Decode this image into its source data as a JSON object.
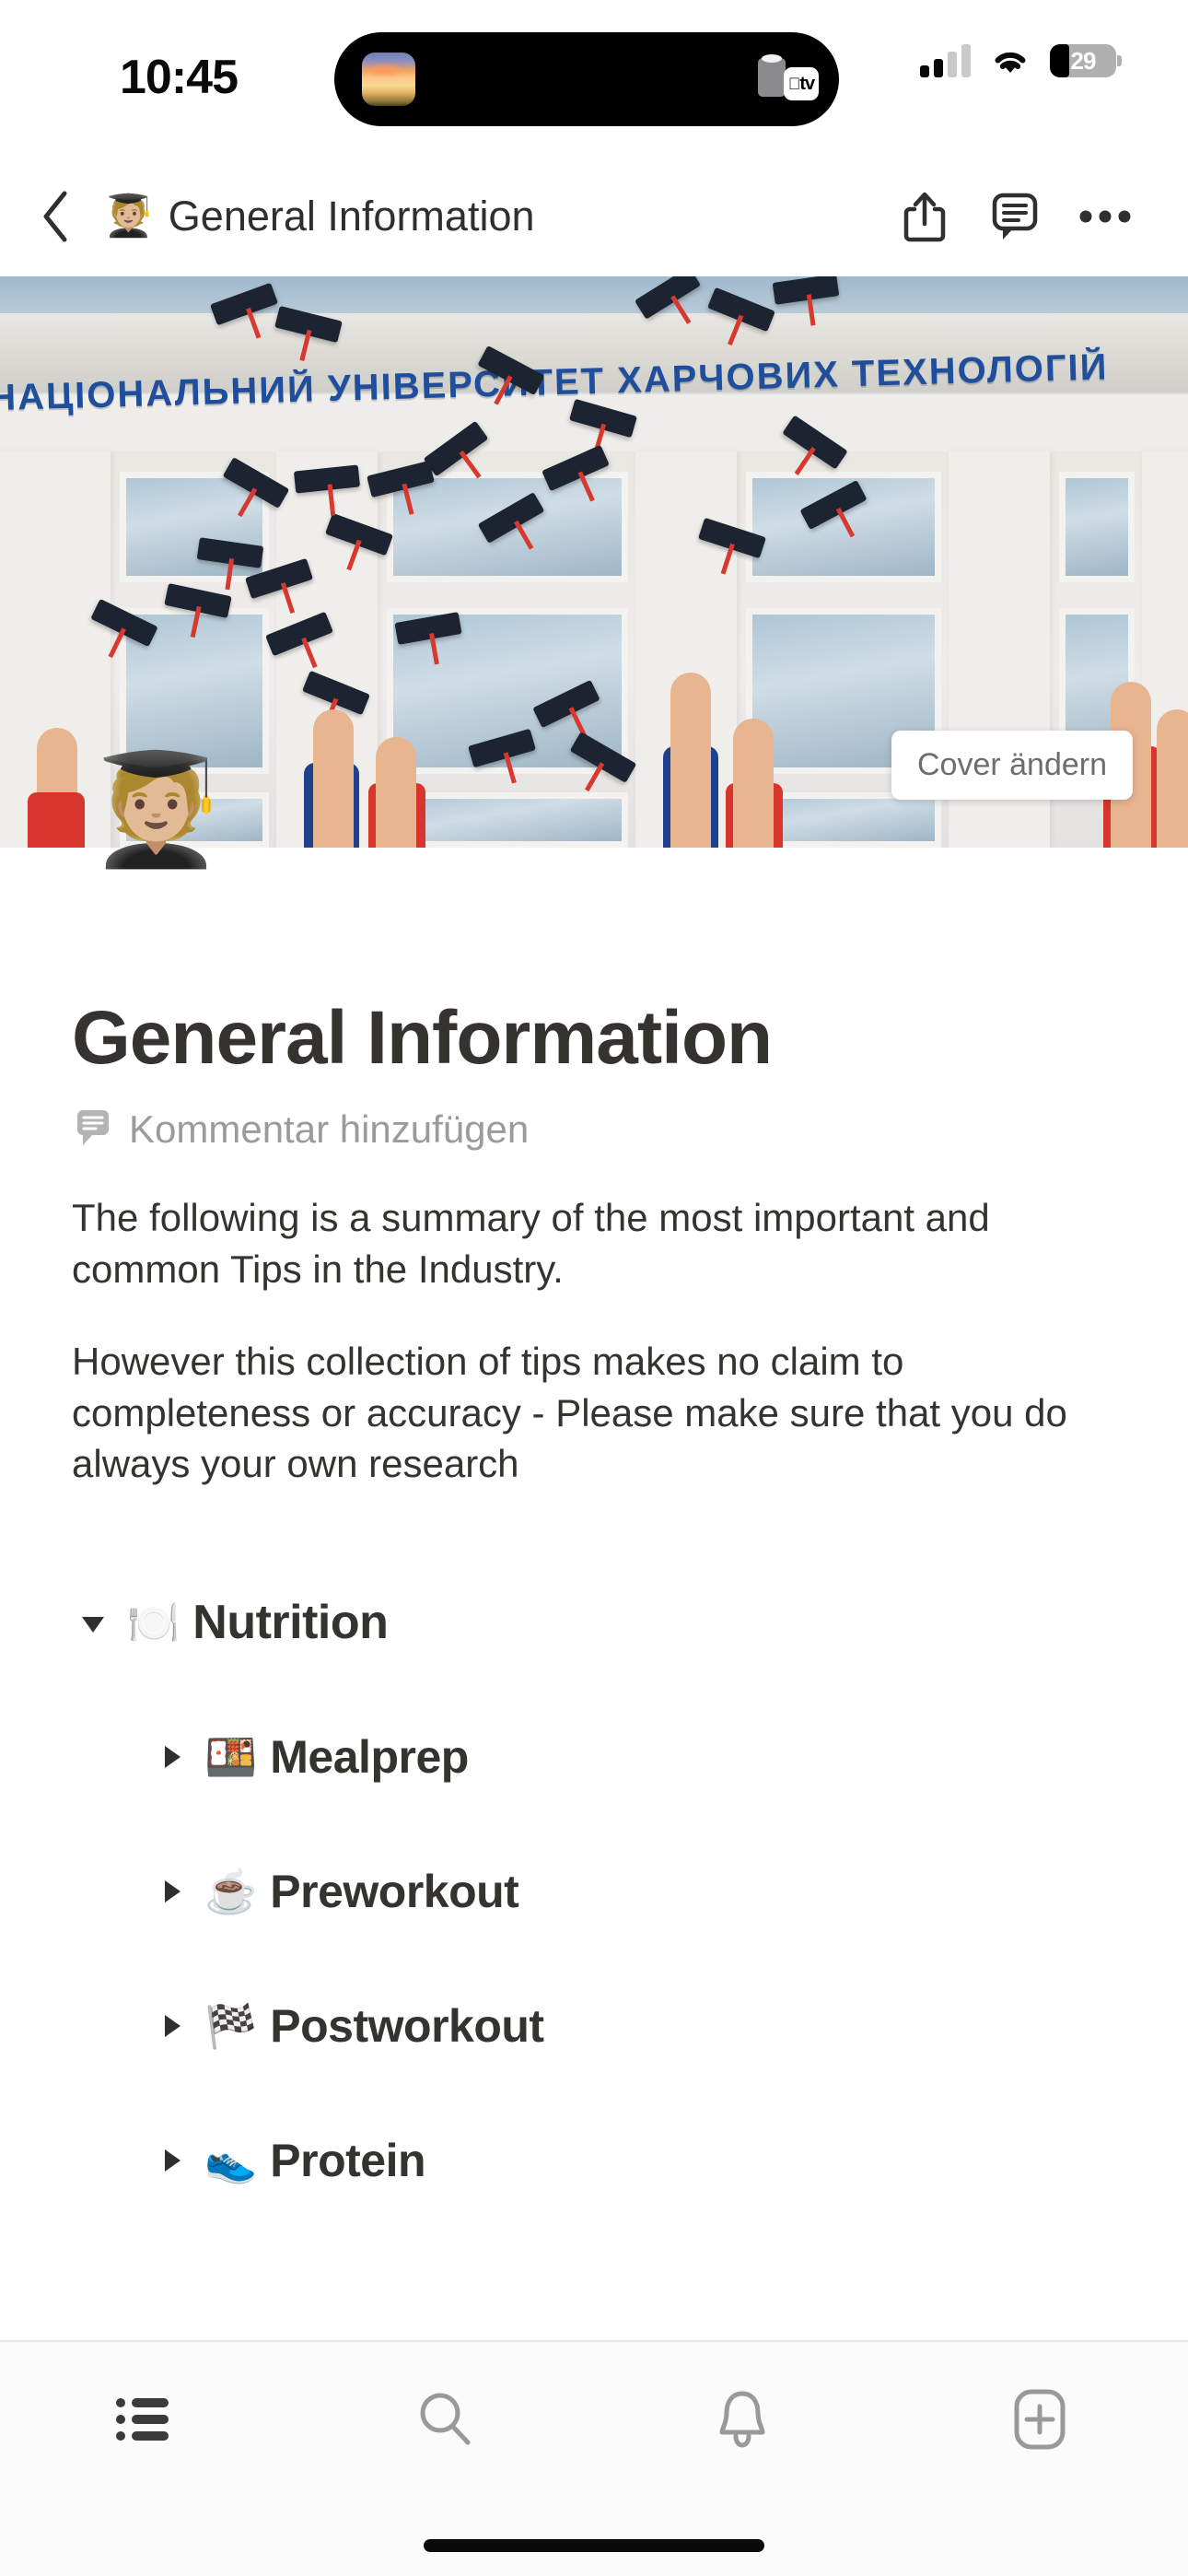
{
  "status_bar": {
    "time": "10:45",
    "signal_bars_filled": 2,
    "signal_bars_total": 4,
    "wifi_icon": "wifi-icon",
    "battery_percent": "29",
    "battery_level": 29,
    "dynamic_island": {
      "left_icon": "album-artwork-thumbnail",
      "right_icon": "apple-tv-icon",
      "right_label": "tv"
    }
  },
  "nav_bar": {
    "back_icon": "chevron-left-icon",
    "page_emoji": "🧑🏼‍🎓",
    "title": "General Information",
    "share_icon": "share-icon",
    "comment_icon": "comment-icon",
    "more_icon": "ellipsis-icon"
  },
  "cover": {
    "image_alt": "graduates throwing caps in front of university building",
    "building_sign_text": "НАЦІОНАЛЬНИЙ УНІВЕРСИТЕТ ХАРЧОВИХ ТЕХНОЛОГІЙ",
    "change_cover_label": "Cover ändern"
  },
  "page": {
    "icon_emoji": "🧑🏼‍🎓",
    "title": "General Information",
    "comment_placeholder": "Kommentar hinzufügen",
    "comment_icon": "comment-icon",
    "paragraphs": [
      "The following is a summary of the most important and common Tips in the Industry.",
      "However this collection of tips makes no claim to completeness or accuracy - Please make sure that you do always your own research"
    ],
    "toggles": [
      {
        "level": 1,
        "expanded": true,
        "arrow": "▼",
        "emoji": "🍽️",
        "label": "Nutrition"
      },
      {
        "level": 2,
        "expanded": false,
        "arrow": "▶",
        "emoji": "🍱",
        "label": "Mealprep"
      },
      {
        "level": 2,
        "expanded": false,
        "arrow": "▶",
        "emoji": "☕",
        "label": "Preworkout"
      },
      {
        "level": 2,
        "expanded": false,
        "arrow": "▶",
        "emoji": "🏁",
        "label": "Postworkout"
      },
      {
        "level": 2,
        "expanded": false,
        "arrow": "▶",
        "emoji": "👟",
        "label": "Protein",
        "clipped": true
      }
    ]
  },
  "tab_bar": {
    "items": [
      {
        "icon": "list-icon",
        "label": "",
        "active": true
      },
      {
        "icon": "search-icon",
        "label": "",
        "active": false
      },
      {
        "icon": "bell-icon",
        "label": "",
        "active": false
      },
      {
        "icon": "plus-square-icon",
        "label": "",
        "active": false
      }
    ]
  },
  "colors": {
    "text_primary": "#34332f",
    "text_muted": "#9b9b9b",
    "sign_blue": "#1f4e9c",
    "tab_active": "#34332f",
    "tab_inactive": "#999999"
  }
}
